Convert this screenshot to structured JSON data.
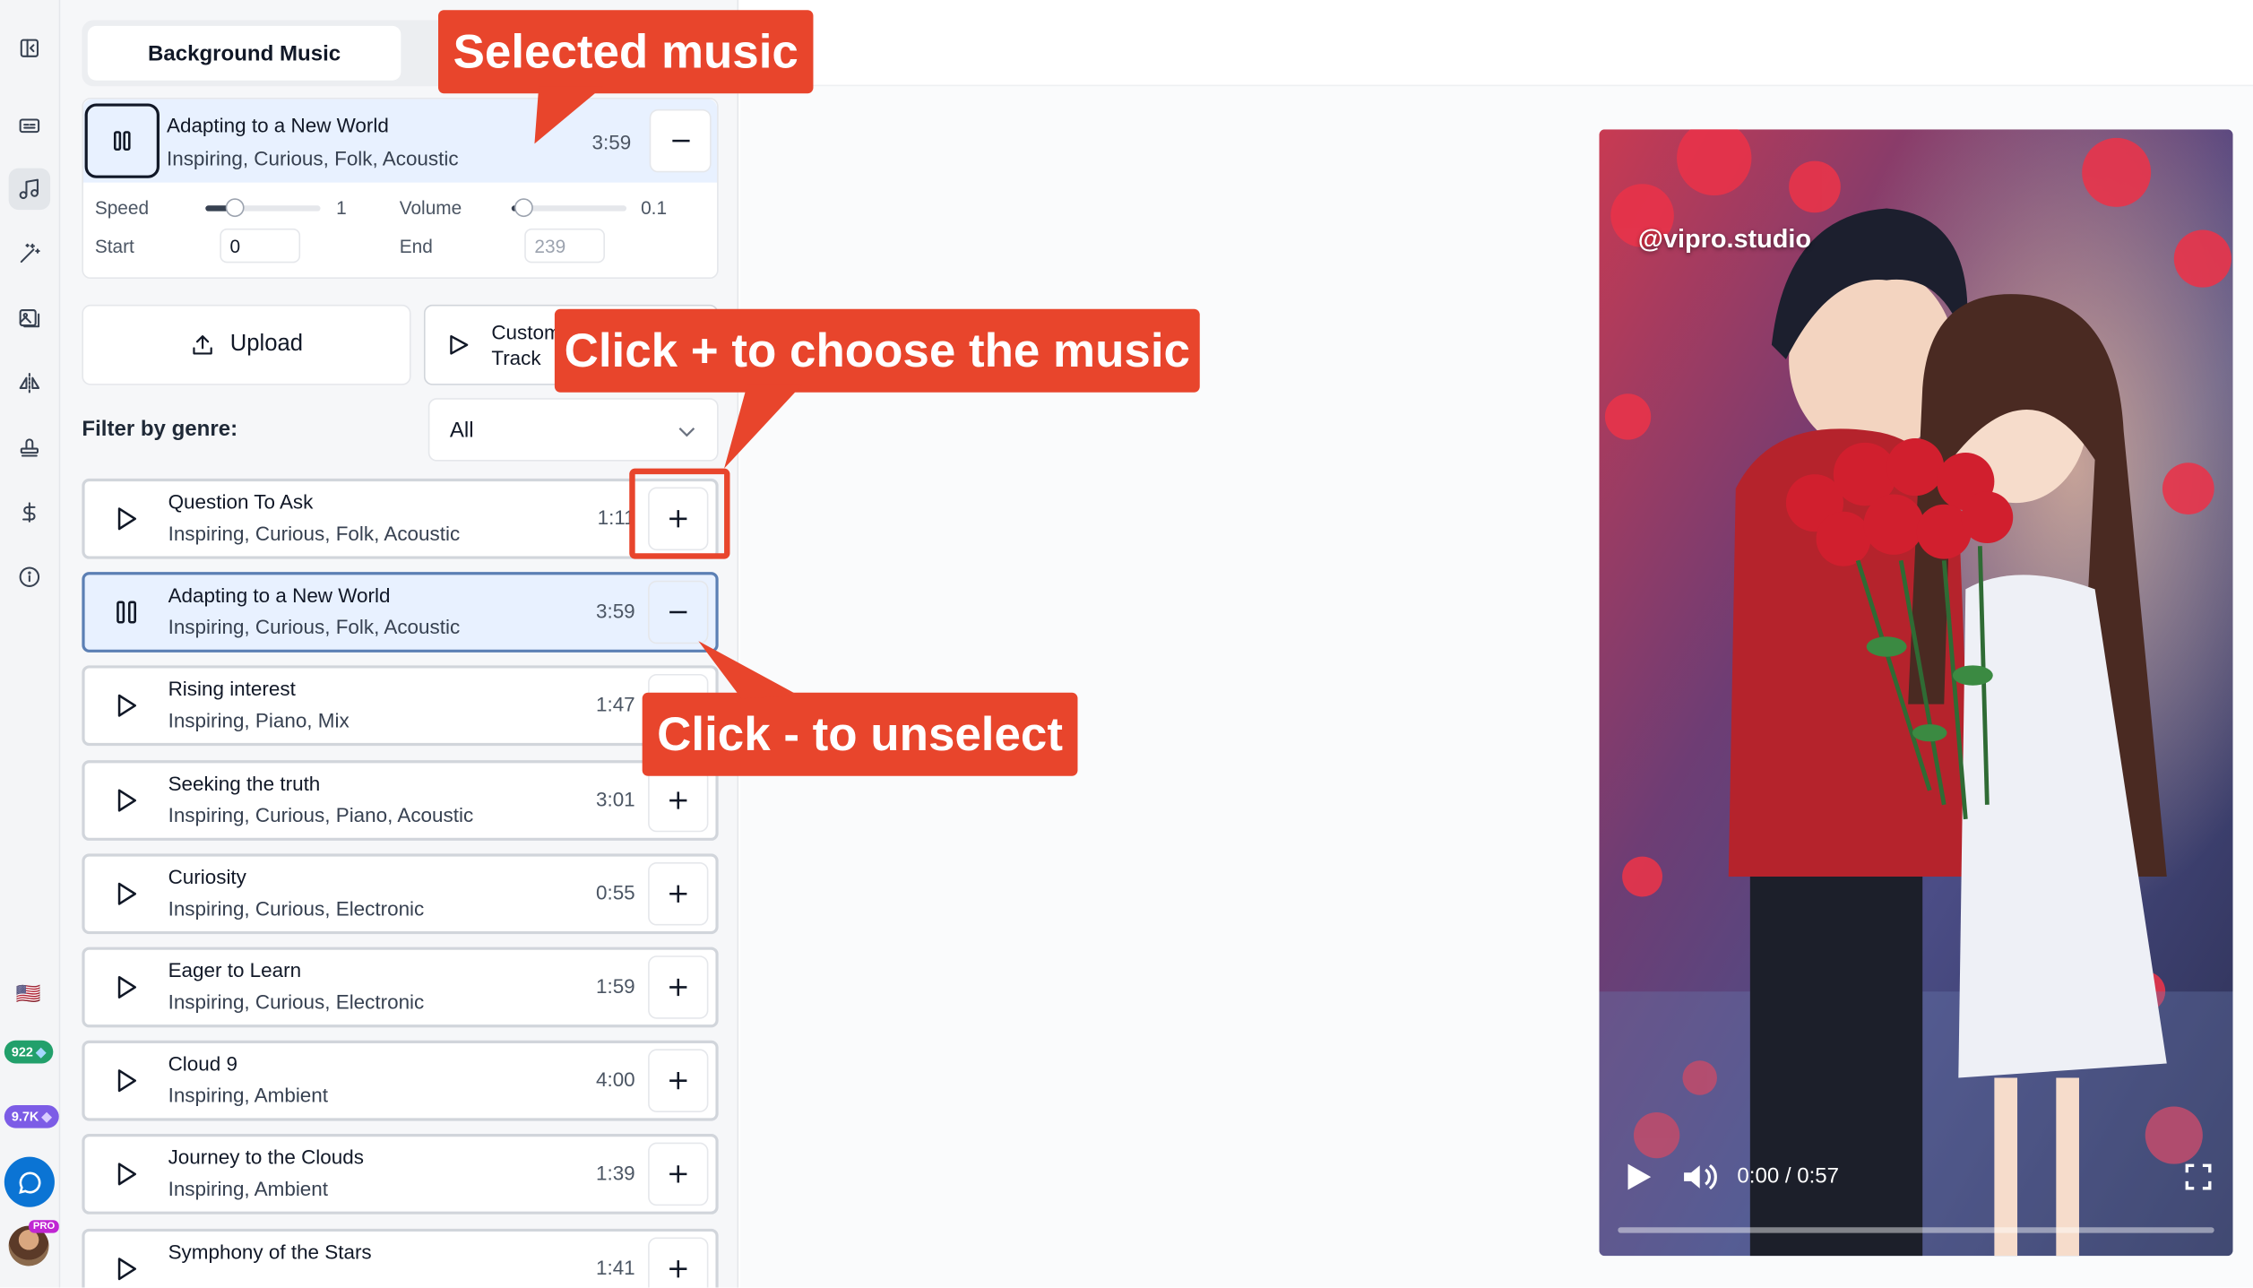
{
  "sidebar": {
    "icons": [
      "collapse-icon",
      "captions-icon",
      "music-icon",
      "magic-wand-icon",
      "images-icon",
      "flip-icon",
      "stamp-icon",
      "dollar-icon",
      "info-icon"
    ],
    "flag": "🇺🇸",
    "credits_badge": "922",
    "points_badge": "9.7K",
    "pro_label": "PRO"
  },
  "panel": {
    "tab_label": "Background Music",
    "selected": {
      "title": "Adapting to a New World",
      "tags": "Inspiring, Curious, Folk, Acoustic",
      "duration": "3:59",
      "speed_label": "Speed",
      "speed_value": "1",
      "speed_level": 0.25,
      "volume_label": "Volume",
      "volume_value": "0.1",
      "volume_level": 0.1,
      "start_label": "Start",
      "start_value": "0",
      "end_label": "End",
      "end_placeholder": "239"
    },
    "upload_label": "Upload",
    "custom_label_1": "Custom",
    "custom_label_2": "Track",
    "filter_label": "Filter by genre:",
    "filter_value": "All",
    "tracks": [
      {
        "title": "Question To Ask",
        "tags": "Inspiring, Curious, Folk, Acoustic",
        "duration": "1:11"
      },
      {
        "title": "Adapting to a New World",
        "tags": "Inspiring, Curious, Folk, Acoustic",
        "duration": "3:59"
      },
      {
        "title": "Rising interest",
        "tags": "Inspiring, Piano, Mix",
        "duration": "1:47"
      },
      {
        "title": "Seeking the truth",
        "tags": "Inspiring, Curious, Piano, Acoustic",
        "duration": "3:01"
      },
      {
        "title": "Curiosity",
        "tags": "Inspiring, Curious, Electronic",
        "duration": "0:55"
      },
      {
        "title": "Eager to Learn",
        "tags": "Inspiring, Curious, Electronic",
        "duration": "1:59"
      },
      {
        "title": "Cloud 9",
        "tags": "Inspiring, Ambient",
        "duration": "4:00"
      },
      {
        "title": "Journey to the Clouds",
        "tags": "Inspiring, Ambient",
        "duration": "1:39"
      },
      {
        "title": "Symphony of the Stars",
        "tags": "",
        "duration": "1:41"
      }
    ]
  },
  "video": {
    "watermark": "@vipro.studio",
    "time": "0:00 / 0:57",
    "progress": 0
  },
  "annotations": {
    "selected_music": "Selected music",
    "click_plus": "Click + to choose the music",
    "click_minus": "Click - to unselect"
  },
  "colors": {
    "accent": "#e8452c",
    "selected_bg": "#e8f1ff",
    "chat": "#0b74d4",
    "credits": "#22a06b",
    "points": "#7c5ce6"
  }
}
